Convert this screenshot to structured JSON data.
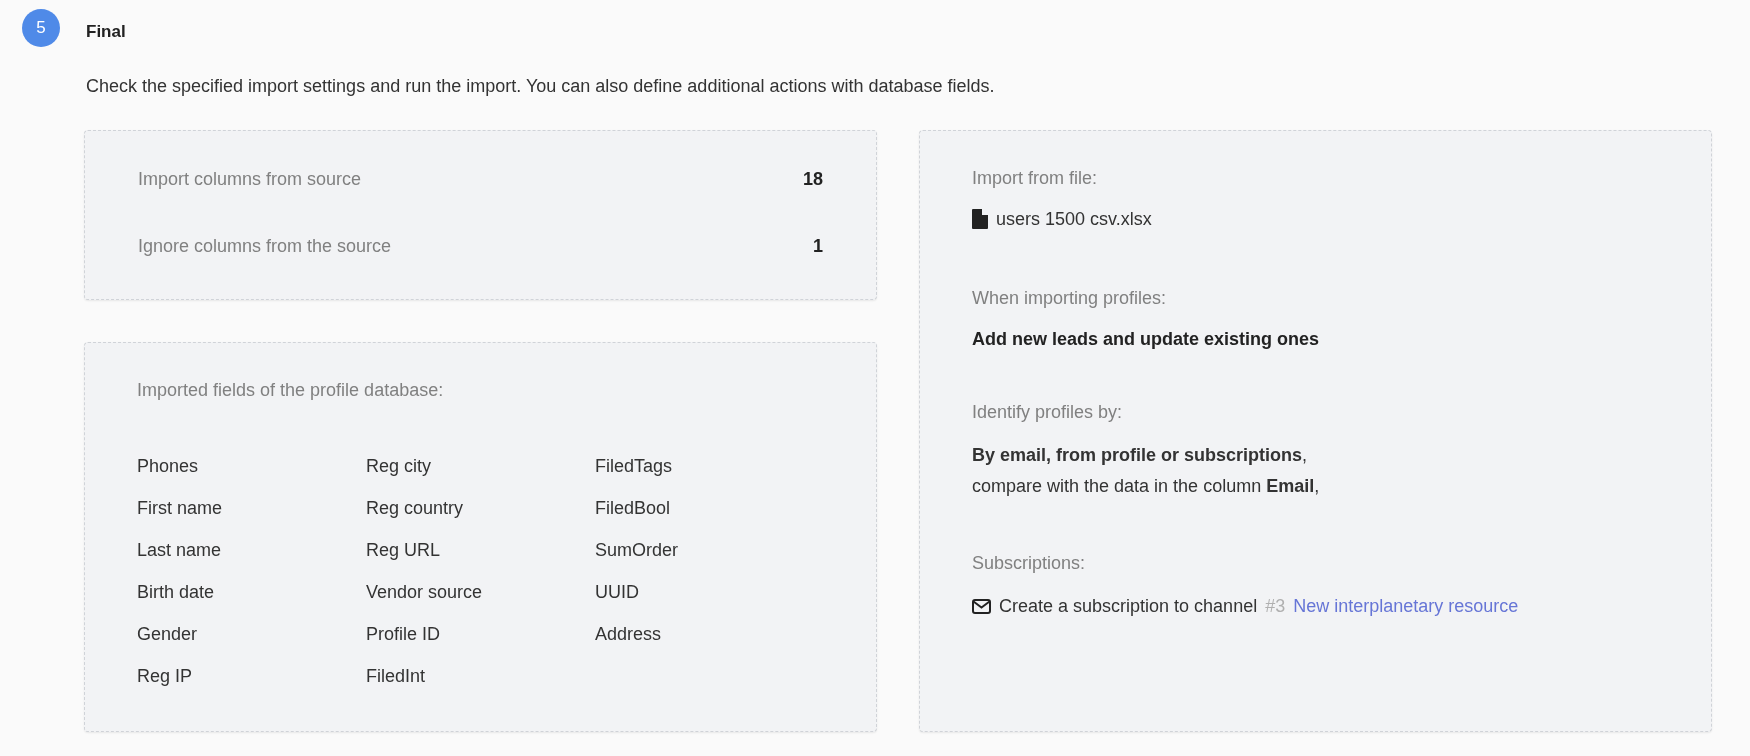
{
  "step": {
    "number": "5",
    "title": "Final",
    "description": "Check the specified import settings and run the import. You can also define additional actions with database fields."
  },
  "summary": [
    {
      "label": "Import columns from source",
      "value": "18"
    },
    {
      "label": "Ignore columns from the source",
      "value": "1"
    }
  ],
  "fields": {
    "heading": "Imported fields of the profile database:",
    "columns": [
      [
        "Phones",
        "First name",
        "Last name",
        "Birth date",
        "Gender",
        "Reg IP"
      ],
      [
        "Reg city",
        "Reg country",
        "Reg URL",
        "Vendor source",
        "Profile ID",
        "FiledInt"
      ],
      [
        "FiledTags",
        "FiledBool",
        "SumOrder",
        "UUID",
        "Address"
      ]
    ]
  },
  "details": {
    "file": {
      "label": "Import from file:",
      "name": "users 1500 csv.xlsx"
    },
    "mode": {
      "label": "When importing profiles:",
      "value": "Add new leads and update existing ones"
    },
    "identify": {
      "label": "Identify profiles by:",
      "lines": [
        "**By email, from profile or subscriptions**,",
        "compare with the data in the column  **Email**,"
      ]
    },
    "subscriptions": {
      "label": "Subscriptions:",
      "text": "Create a subscription to channel",
      "channel_number": "#3",
      "channel_name": "New interplanetary resource"
    }
  }
}
